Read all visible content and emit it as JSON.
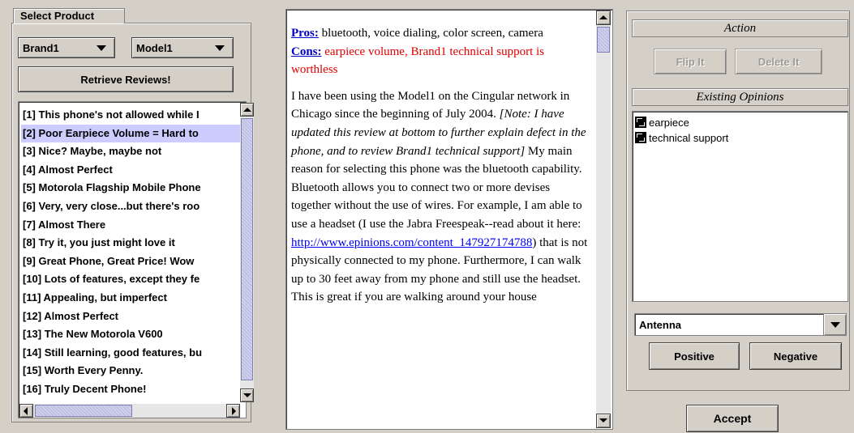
{
  "product": {
    "tab_label": "Select Product",
    "brand": "Brand1",
    "model": "Model1",
    "retrieve_label": "Retrieve Reviews!"
  },
  "reviews": [
    "[1]  This phone's not allowed while I",
    "[2]  Poor Earpiece Volume = Hard to",
    "[3]  Nice? Maybe, maybe not",
    "[4]  Almost Perfect",
    "[5]  Motorola Flagship Mobile Phone",
    "[6]  Very, very close...but there's roo",
    "[7]  Almost There",
    "[8]  Try it, you just might love it",
    "[9]  Great Phone, Great Price! Wow",
    "[10]  Lots of features, except they fe",
    "[11]  Appealing, but imperfect",
    "[12]  Almost Perfect",
    "[13]  The New Motorola V600",
    "[14]  Still learning, good features, bu",
    "[15]  Worth Every Penny.",
    "[16]  Truly Decent Phone!"
  ],
  "selected_review_index": 1,
  "review": {
    "pros_label": "Pros:",
    "pros_text": " bluetooth, voice dialing, color screen, camera",
    "cons_label": "Cons:",
    "cons_text": " earpiece volume, Brand1 technical support is worthless",
    "body_1": " I have been using the Model1 on the Cingular network in Chicago since the beginning of July 2004. ",
    "body_note": "[Note: I have updated this review at bottom to further explain defect in the phone, and to review Brand1 technical support]",
    "body_2": " My main reason for selecting this phone was the bluetooth capability. Bluetooth allows you to connect two or more devises together without the use of wires. For example, I am able to use a headset (I use the Jabra Freespeak--read about it here: ",
    "link_text": "http://www.epinions.com/content_147927174788",
    "body_3": ") that is not physically connected to my phone. Furthermore, I can walk up to 30 feet away from my phone and still use the headset. This is great if you are walking around your house"
  },
  "action": {
    "header": "Action",
    "flip_label": "Flip It",
    "delete_label": "Delete It"
  },
  "opinions": {
    "header": "Existing Opinions",
    "items": [
      "earpiece",
      "technical support"
    ]
  },
  "attribute": {
    "selected": "Antenna",
    "positive_label": "Positive",
    "negative_label": "Negative"
  },
  "accept_label": "Accept",
  "colors": {
    "background": "#d4d0c8",
    "selection": "#ccccff",
    "pros_link": "#0000cc",
    "cons_text": "#e00000"
  }
}
